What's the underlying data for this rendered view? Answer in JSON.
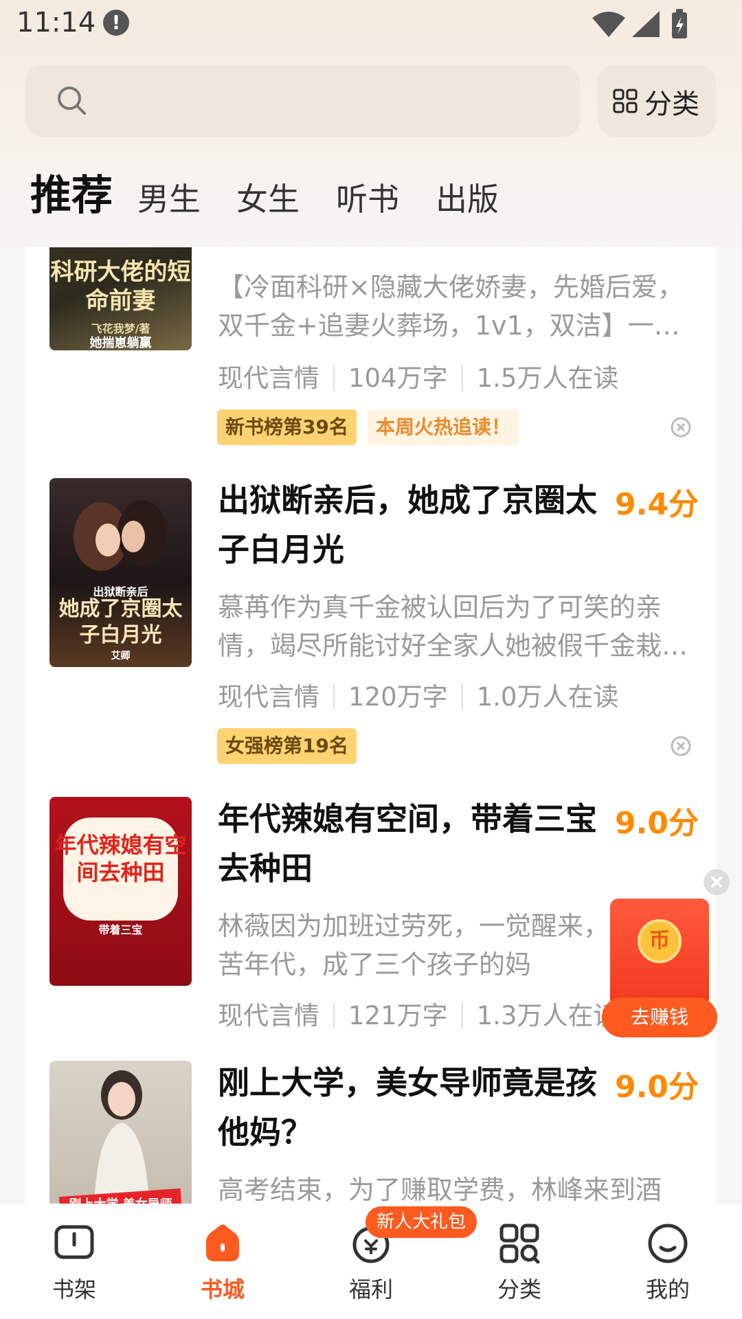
{
  "status_bar": {
    "time": "11:14",
    "alert_icon": "exclamation-icon",
    "icons": [
      "wifi-icon",
      "signal-icon",
      "battery-charging-icon"
    ]
  },
  "search": {
    "placeholder": "",
    "icon": "search-icon"
  },
  "category_button": {
    "label": "分类",
    "icon": "grid-icon"
  },
  "tabs": [
    {
      "label": "推荐",
      "active": true
    },
    {
      "label": "男生"
    },
    {
      "label": "女生"
    },
    {
      "label": "听书"
    },
    {
      "label": "出版"
    }
  ],
  "books": [
    {
      "cover_title": "科研大佬的短命前妻",
      "cover_subtitle": "她揣崽躺赢",
      "cover_author": "飞花我梦/著",
      "description": "【冷面科研×隐藏大佬娇妻，先婚后爱，双千金+追妻火葬场，1v1，双洁】一…",
      "category": "现代言情",
      "words": "104万字",
      "readers": "1.5万人在读",
      "badges": [
        "新书榜第39名",
        "本周火热追读！"
      ]
    },
    {
      "title": "出狱断亲后，她成了京圈太子白月光",
      "score": "9.4分",
      "cover_title": "她成了京圈太子白月光",
      "cover_subtitle": "出狱断亲后",
      "cover_author": "艾卿",
      "description": "慕苒作为真千金被认回后为了可笑的亲情，竭尽所能讨好全家人她被假千金栽…",
      "category": "现代言情",
      "words": "120万字",
      "readers": "1.0万人在读",
      "badges": [
        "女强榜第19名"
      ]
    },
    {
      "title": "年代辣媳有空间，带着三宝去种田",
      "score": "9.0分",
      "cover_title": "年代辣媳有空间去种田",
      "cover_subtitle": "带着三宝",
      "description": "林薇因为加班过劳死，一觉醒来，到了穷苦年代，成了三个孩子的妈",
      "category": "现代言情",
      "words": "121万字",
      "readers": "1.3万人在读"
    },
    {
      "title": "刚上大学，美女导师竟是孩他妈？",
      "score": "9.0分",
      "cover_title": "刚上大学 美女导师",
      "description": "高考结束，为了赚取学费，林峰来到酒"
    }
  ],
  "float_reward": {
    "label": "去赚钱",
    "coin": "币"
  },
  "bottom_nav": [
    {
      "label": "书架",
      "icon": "bookshelf-icon"
    },
    {
      "label": "书城",
      "icon": "bookstore-icon",
      "active": true
    },
    {
      "label": "福利",
      "icon": "welfare-icon"
    },
    {
      "label": "分类",
      "icon": "category-icon"
    },
    {
      "label": "我的",
      "icon": "profile-icon"
    }
  ],
  "nav_badge": "新人大礼包",
  "colors": {
    "accent": "#ff5a1f",
    "score": "#ff8a00",
    "badge_yellow": "#ffd372",
    "background_top": "#f4ebdf"
  }
}
